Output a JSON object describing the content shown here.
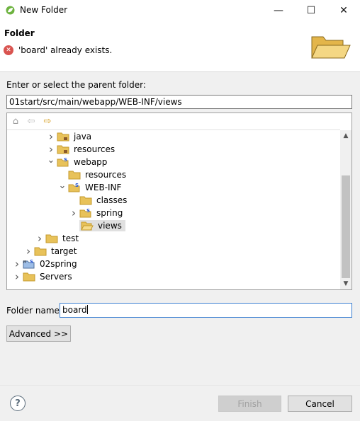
{
  "window": {
    "title": "New Folder",
    "minimize_glyph": "—",
    "maximize_glyph": "☐",
    "close_glyph": "✕"
  },
  "header": {
    "title": "Folder",
    "error_message": "'board' already exists.",
    "error_icon": "error-x-icon",
    "banner_icon": "open-folder-icon"
  },
  "parent": {
    "label": "Enter or select the parent folder:",
    "value": "01start/src/main/webapp/WEB-INF/views"
  },
  "toolbar": {
    "home_icon": "home-icon",
    "back_icon": "back-arrow-icon",
    "forward_icon": "forward-arrow-icon"
  },
  "tree": {
    "items": [
      {
        "label": "java",
        "expander": "collapsed",
        "icon": "folder-package-icon"
      },
      {
        "label": "resources",
        "expander": "collapsed",
        "icon": "folder-package-icon"
      },
      {
        "label": "webapp",
        "expander": "expanded",
        "icon": "spring-folder-icon"
      },
      {
        "label": "resources",
        "expander": "none",
        "icon": "folder-icon"
      },
      {
        "label": "WEB-INF",
        "expander": "expanded",
        "icon": "spring-folder-icon"
      },
      {
        "label": "classes",
        "expander": "none",
        "icon": "folder-icon"
      },
      {
        "label": "spring",
        "expander": "collapsed",
        "icon": "spring-folder-icon"
      },
      {
        "label": "views",
        "expander": "none",
        "icon": "open-folder-icon",
        "selected": true
      },
      {
        "label": "test",
        "expander": "collapsed",
        "icon": "folder-icon"
      },
      {
        "label": "target",
        "expander": "collapsed",
        "icon": "folder-icon"
      },
      {
        "label": "02spring",
        "expander": "collapsed",
        "icon": "maven-spring-project-icon"
      },
      {
        "label": "Servers",
        "expander": "collapsed",
        "icon": "folder-icon"
      }
    ]
  },
  "folder_name": {
    "label": "Folder name:",
    "value": "board"
  },
  "buttons": {
    "advanced": "Advanced >>",
    "finish": "Finish",
    "cancel": "Cancel",
    "help_glyph": "?"
  },
  "colors": {
    "folder": "#e8c25a",
    "folder_dark": "#c49a2c",
    "error": "#d9534f",
    "spring_blue": "#2a5bd7"
  }
}
